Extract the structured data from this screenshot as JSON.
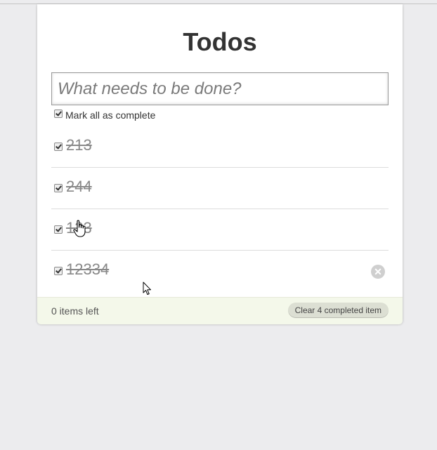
{
  "app": {
    "title": "Todos"
  },
  "new_todo": {
    "placeholder": "What needs to be done?",
    "value": ""
  },
  "toggle_all": {
    "label": "Mark all as complete",
    "checked": true
  },
  "todos": [
    {
      "text": "213",
      "completed": true
    },
    {
      "text": "244",
      "completed": true
    },
    {
      "text": "123",
      "completed": true
    },
    {
      "text": "12334",
      "completed": true
    }
  ],
  "footer": {
    "count_text": "0 items left",
    "clear_label": "Clear 4 completed item"
  },
  "icons": {
    "destroy": "close-circle-icon",
    "checkbox": "checkmark-icon"
  }
}
